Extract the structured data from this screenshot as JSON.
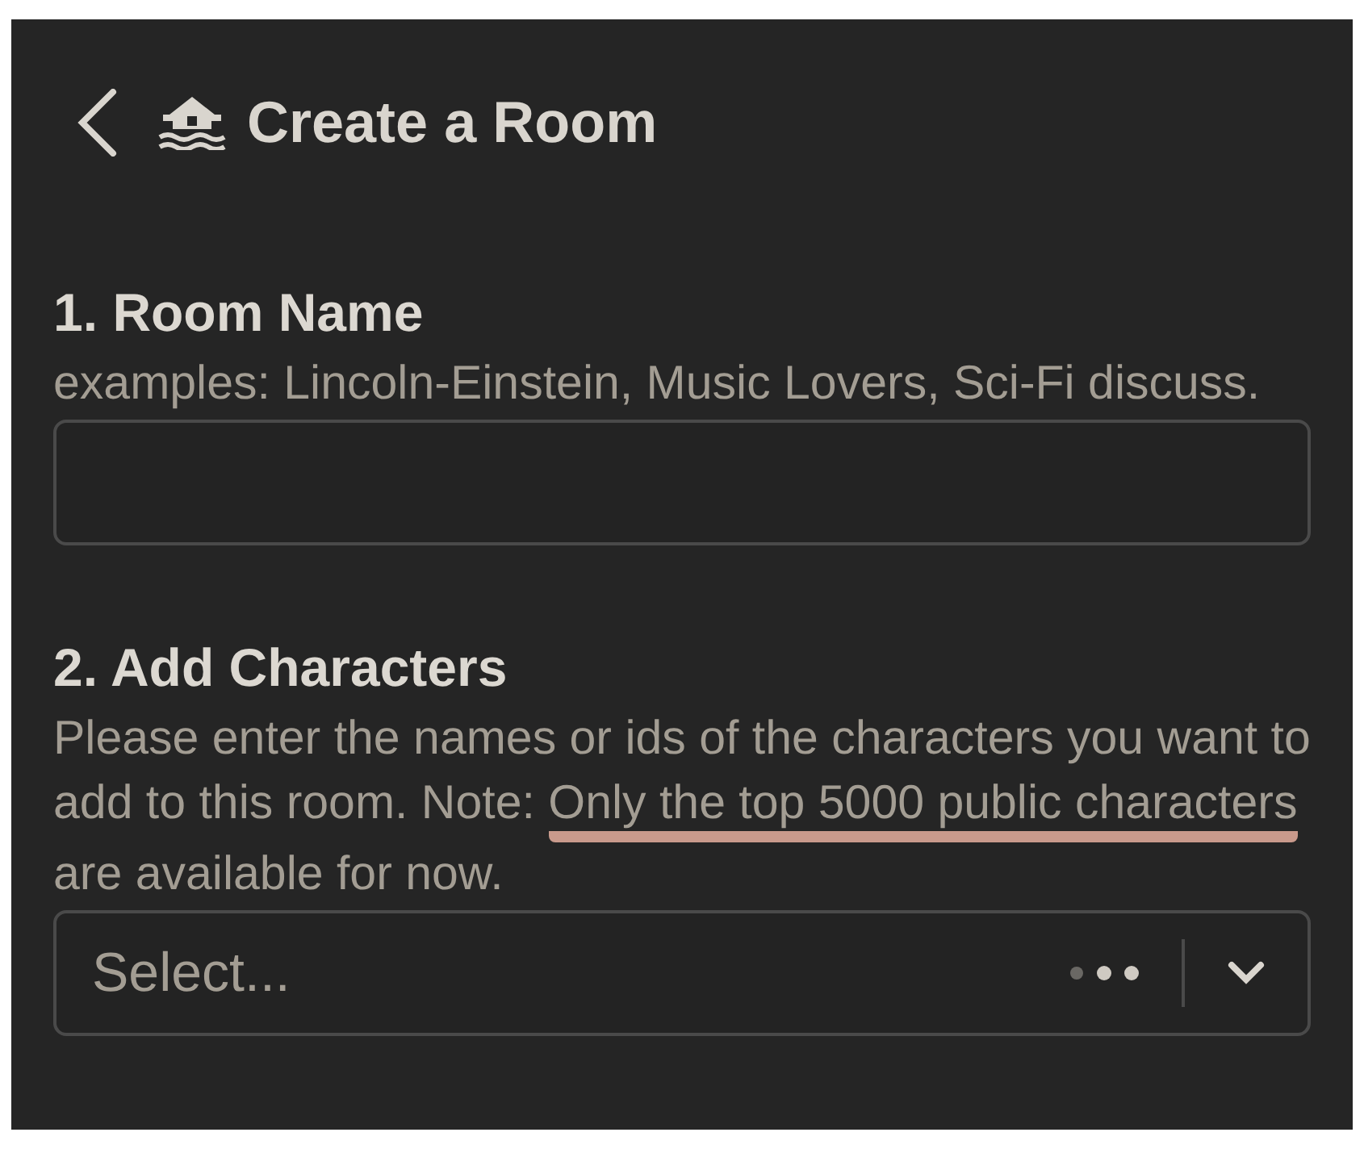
{
  "header": {
    "title": "Create a Room"
  },
  "sections": [
    {
      "heading": "1. Room Name",
      "hint": "examples: Lincoln-Einstein, Music Lovers, Sci-Fi discuss.",
      "kind": "text"
    },
    {
      "heading": "2. Add Characters",
      "hint_parts": [
        {
          "text": "Please enter the names or ids of the characters you want to add to this room. Note: ",
          "underlined": false
        },
        {
          "text": "Only the top 5000 public characters",
          "underlined": true
        },
        {
          "text": " are available for now.",
          "underlined": false
        }
      ],
      "kind": "select",
      "placeholder": "Select...",
      "loading": true
    }
  ]
}
